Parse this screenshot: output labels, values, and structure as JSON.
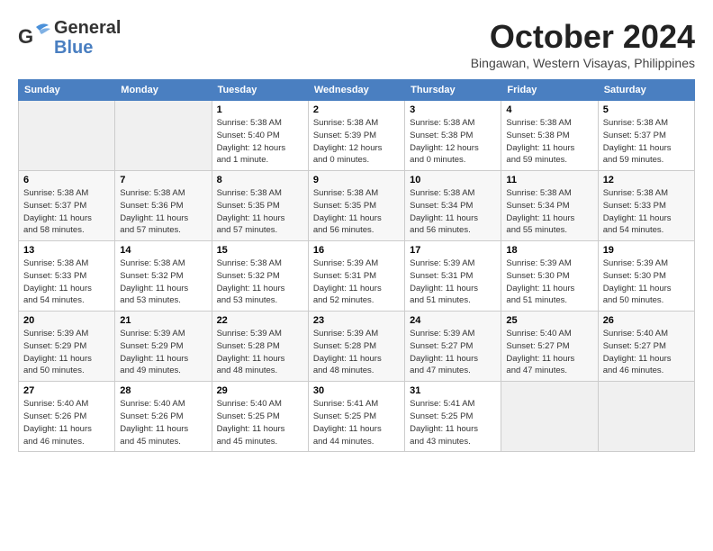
{
  "header": {
    "logo_line1": "General",
    "logo_line2": "Blue",
    "month": "October 2024",
    "location": "Bingawan, Western Visayas, Philippines"
  },
  "weekdays": [
    "Sunday",
    "Monday",
    "Tuesday",
    "Wednesday",
    "Thursday",
    "Friday",
    "Saturday"
  ],
  "weeks": [
    [
      {
        "day": "",
        "detail": ""
      },
      {
        "day": "",
        "detail": ""
      },
      {
        "day": "1",
        "detail": "Sunrise: 5:38 AM\nSunset: 5:40 PM\nDaylight: 12 hours\nand 1 minute."
      },
      {
        "day": "2",
        "detail": "Sunrise: 5:38 AM\nSunset: 5:39 PM\nDaylight: 12 hours\nand 0 minutes."
      },
      {
        "day": "3",
        "detail": "Sunrise: 5:38 AM\nSunset: 5:38 PM\nDaylight: 12 hours\nand 0 minutes."
      },
      {
        "day": "4",
        "detail": "Sunrise: 5:38 AM\nSunset: 5:38 PM\nDaylight: 11 hours\nand 59 minutes."
      },
      {
        "day": "5",
        "detail": "Sunrise: 5:38 AM\nSunset: 5:37 PM\nDaylight: 11 hours\nand 59 minutes."
      }
    ],
    [
      {
        "day": "6",
        "detail": "Sunrise: 5:38 AM\nSunset: 5:37 PM\nDaylight: 11 hours\nand 58 minutes."
      },
      {
        "day": "7",
        "detail": "Sunrise: 5:38 AM\nSunset: 5:36 PM\nDaylight: 11 hours\nand 57 minutes."
      },
      {
        "day": "8",
        "detail": "Sunrise: 5:38 AM\nSunset: 5:35 PM\nDaylight: 11 hours\nand 57 minutes."
      },
      {
        "day": "9",
        "detail": "Sunrise: 5:38 AM\nSunset: 5:35 PM\nDaylight: 11 hours\nand 56 minutes."
      },
      {
        "day": "10",
        "detail": "Sunrise: 5:38 AM\nSunset: 5:34 PM\nDaylight: 11 hours\nand 56 minutes."
      },
      {
        "day": "11",
        "detail": "Sunrise: 5:38 AM\nSunset: 5:34 PM\nDaylight: 11 hours\nand 55 minutes."
      },
      {
        "day": "12",
        "detail": "Sunrise: 5:38 AM\nSunset: 5:33 PM\nDaylight: 11 hours\nand 54 minutes."
      }
    ],
    [
      {
        "day": "13",
        "detail": "Sunrise: 5:38 AM\nSunset: 5:33 PM\nDaylight: 11 hours\nand 54 minutes."
      },
      {
        "day": "14",
        "detail": "Sunrise: 5:38 AM\nSunset: 5:32 PM\nDaylight: 11 hours\nand 53 minutes."
      },
      {
        "day": "15",
        "detail": "Sunrise: 5:38 AM\nSunset: 5:32 PM\nDaylight: 11 hours\nand 53 minutes."
      },
      {
        "day": "16",
        "detail": "Sunrise: 5:39 AM\nSunset: 5:31 PM\nDaylight: 11 hours\nand 52 minutes."
      },
      {
        "day": "17",
        "detail": "Sunrise: 5:39 AM\nSunset: 5:31 PM\nDaylight: 11 hours\nand 51 minutes."
      },
      {
        "day": "18",
        "detail": "Sunrise: 5:39 AM\nSunset: 5:30 PM\nDaylight: 11 hours\nand 51 minutes."
      },
      {
        "day": "19",
        "detail": "Sunrise: 5:39 AM\nSunset: 5:30 PM\nDaylight: 11 hours\nand 50 minutes."
      }
    ],
    [
      {
        "day": "20",
        "detail": "Sunrise: 5:39 AM\nSunset: 5:29 PM\nDaylight: 11 hours\nand 50 minutes."
      },
      {
        "day": "21",
        "detail": "Sunrise: 5:39 AM\nSunset: 5:29 PM\nDaylight: 11 hours\nand 49 minutes."
      },
      {
        "day": "22",
        "detail": "Sunrise: 5:39 AM\nSunset: 5:28 PM\nDaylight: 11 hours\nand 48 minutes."
      },
      {
        "day": "23",
        "detail": "Sunrise: 5:39 AM\nSunset: 5:28 PM\nDaylight: 11 hours\nand 48 minutes."
      },
      {
        "day": "24",
        "detail": "Sunrise: 5:39 AM\nSunset: 5:27 PM\nDaylight: 11 hours\nand 47 minutes."
      },
      {
        "day": "25",
        "detail": "Sunrise: 5:40 AM\nSunset: 5:27 PM\nDaylight: 11 hours\nand 47 minutes."
      },
      {
        "day": "26",
        "detail": "Sunrise: 5:40 AM\nSunset: 5:27 PM\nDaylight: 11 hours\nand 46 minutes."
      }
    ],
    [
      {
        "day": "27",
        "detail": "Sunrise: 5:40 AM\nSunset: 5:26 PM\nDaylight: 11 hours\nand 46 minutes."
      },
      {
        "day": "28",
        "detail": "Sunrise: 5:40 AM\nSunset: 5:26 PM\nDaylight: 11 hours\nand 45 minutes."
      },
      {
        "day": "29",
        "detail": "Sunrise: 5:40 AM\nSunset: 5:25 PM\nDaylight: 11 hours\nand 45 minutes."
      },
      {
        "day": "30",
        "detail": "Sunrise: 5:41 AM\nSunset: 5:25 PM\nDaylight: 11 hours\nand 44 minutes."
      },
      {
        "day": "31",
        "detail": "Sunrise: 5:41 AM\nSunset: 5:25 PM\nDaylight: 11 hours\nand 43 minutes."
      },
      {
        "day": "",
        "detail": ""
      },
      {
        "day": "",
        "detail": ""
      }
    ]
  ]
}
